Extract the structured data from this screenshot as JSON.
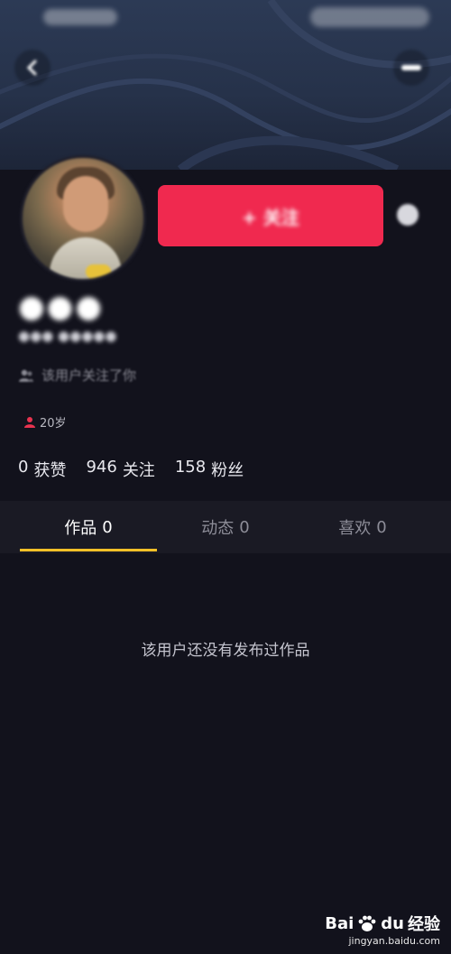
{
  "profile": {
    "follow_button": "+ 关注",
    "follow_hint": "该用户关注了你",
    "age": "20岁",
    "stats": [
      {
        "value": "0",
        "label": "获赞"
      },
      {
        "value": "946",
        "label": "关注"
      },
      {
        "value": "158",
        "label": "粉丝"
      }
    ]
  },
  "tabs": [
    {
      "label": "作品",
      "count": "0",
      "active": true
    },
    {
      "label": "动态",
      "count": "0",
      "active": false
    },
    {
      "label": "喜欢",
      "count": "0",
      "active": false
    }
  ],
  "empty_message": "该用户还没有发布过作品",
  "watermark": {
    "brand_bai": "Bai",
    "brand_du": "du",
    "brand_suffix": "经验",
    "url": "jingyan.baidu.com"
  },
  "colors": {
    "background": "#12121c",
    "header": "#26324a",
    "accent_red": "#f0294f",
    "tab_indicator": "#f5c028"
  },
  "icons": [
    "back-arrow-icon",
    "more-icon",
    "dropdown-icon",
    "users-icon",
    "person-icon",
    "paw-icon"
  ]
}
